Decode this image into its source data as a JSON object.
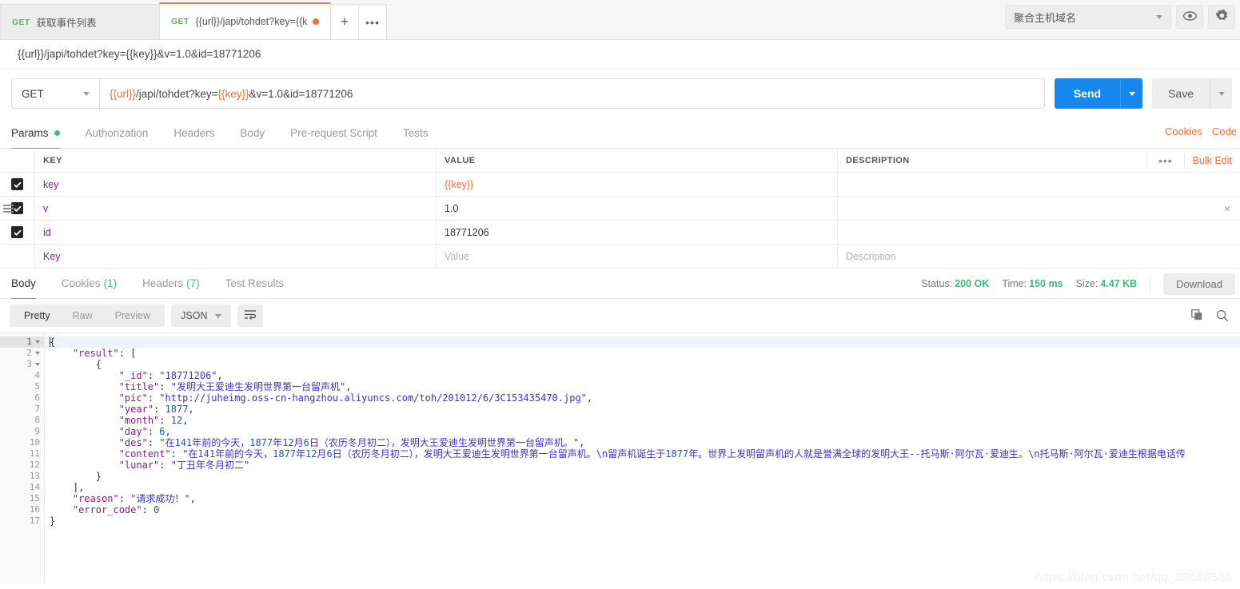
{
  "tabbar": {
    "tabs": [
      {
        "method": "GET",
        "title": "获取事件列表",
        "active": false,
        "dirty": false
      },
      {
        "method": "GET",
        "title": "{{url}}/japi/tohdet?key={{key}}&v",
        "active": true,
        "dirty": true
      }
    ],
    "new_tab_label": "+",
    "more_label": "•••",
    "environment": "聚合主机域名",
    "eye_icon": "eye-icon",
    "gear_icon": "gear-icon"
  },
  "url_preview": "{{url}}/japi/tohdet?key={{key}}&v=1.0&id=18771206",
  "request": {
    "method": "GET",
    "url_parts": [
      {
        "text": "{{url}}",
        "variable": true
      },
      {
        "text": "/japi/tohdet?key=",
        "variable": false
      },
      {
        "text": "{{key}}",
        "variable": true
      },
      {
        "text": "&v=1.0&id=18771206",
        "variable": false
      }
    ],
    "send_label": "Send",
    "save_label": "Save"
  },
  "request_tabs": {
    "items": [
      {
        "label": "Params",
        "active": true,
        "dot": true
      },
      {
        "label": "Authorization",
        "active": false,
        "dot": false
      },
      {
        "label": "Headers",
        "active": false,
        "dot": false
      },
      {
        "label": "Body",
        "active": false,
        "dot": false
      },
      {
        "label": "Pre-request Script",
        "active": false,
        "dot": false
      },
      {
        "label": "Tests",
        "active": false,
        "dot": false
      }
    ],
    "links": [
      "Cookies",
      "Code"
    ]
  },
  "params": {
    "columns": [
      "KEY",
      "VALUE",
      "DESCRIPTION"
    ],
    "dots_label": "•••",
    "bulk_edit_label": "Bulk Edit",
    "rows": [
      {
        "checked": true,
        "key": "key",
        "value": "{{key}}",
        "value_is_variable": true,
        "description": "",
        "hovered": false
      },
      {
        "checked": true,
        "key": "v",
        "value": "1.0",
        "value_is_variable": false,
        "description": "",
        "hovered": true
      },
      {
        "checked": true,
        "key": "id",
        "value": "18771206",
        "value_is_variable": false,
        "description": "",
        "hovered": false
      }
    ],
    "empty_row": {
      "key_placeholder": "Key",
      "value_placeholder": "Value",
      "description_placeholder": "Description"
    }
  },
  "response": {
    "tabs": [
      {
        "label": "Body",
        "count": "",
        "active": true
      },
      {
        "label": "Cookies",
        "count": "(1)",
        "active": false
      },
      {
        "label": "Headers",
        "count": "(7)",
        "active": false
      },
      {
        "label": "Test Results",
        "count": "",
        "active": false
      }
    ],
    "status_label": "Status:",
    "status_value": "200 OK",
    "time_label": "Time:",
    "time_value": "150 ms",
    "size_label": "Size:",
    "size_value": "4.47 KB",
    "download_label": "Download",
    "view_modes": [
      {
        "label": "Pretty",
        "active": true
      },
      {
        "label": "Raw",
        "active": false
      },
      {
        "label": "Preview",
        "active": false
      }
    ],
    "format": "JSON",
    "wrap_icon": "word-wrap-icon",
    "copy_icon": "copy-icon",
    "search_icon": "search-icon"
  },
  "code": {
    "lines": [
      {
        "n": 1,
        "fold": true,
        "active": true,
        "tokens": [
          {
            "t": "{",
            "c": "p"
          }
        ]
      },
      {
        "n": 2,
        "fold": true,
        "active": false,
        "tokens": [
          {
            "t": "    ",
            "c": "p"
          },
          {
            "t": "\"result\"",
            "c": "k"
          },
          {
            "t": ": [",
            "c": "p"
          }
        ]
      },
      {
        "n": 3,
        "fold": true,
        "active": false,
        "tokens": [
          {
            "t": "        {",
            "c": "p"
          }
        ]
      },
      {
        "n": 4,
        "fold": false,
        "active": false,
        "tokens": [
          {
            "t": "            ",
            "c": "p"
          },
          {
            "t": "\"_id\"",
            "c": "k"
          },
          {
            "t": ": ",
            "c": "p"
          },
          {
            "t": "\"18771206\"",
            "c": "s"
          },
          {
            "t": ",",
            "c": "p"
          }
        ]
      },
      {
        "n": 5,
        "fold": false,
        "active": false,
        "tokens": [
          {
            "t": "            ",
            "c": "p"
          },
          {
            "t": "\"title\"",
            "c": "k"
          },
          {
            "t": ": ",
            "c": "p"
          },
          {
            "t": "\"发明大王爱迪生发明世界第一台留声机\"",
            "c": "s"
          },
          {
            "t": ",",
            "c": "p"
          }
        ]
      },
      {
        "n": 6,
        "fold": false,
        "active": false,
        "tokens": [
          {
            "t": "            ",
            "c": "p"
          },
          {
            "t": "\"pic\"",
            "c": "k"
          },
          {
            "t": ": ",
            "c": "p"
          },
          {
            "t": "\"http://juheimg.oss-cn-hangzhou.aliyuncs.com/toh/201012/6/3C153435470.jpg\"",
            "c": "s"
          },
          {
            "t": ",",
            "c": "p"
          }
        ]
      },
      {
        "n": 7,
        "fold": false,
        "active": false,
        "tokens": [
          {
            "t": "            ",
            "c": "p"
          },
          {
            "t": "\"year\"",
            "c": "k"
          },
          {
            "t": ": ",
            "c": "p"
          },
          {
            "t": "1877",
            "c": "n"
          },
          {
            "t": ",",
            "c": "p"
          }
        ]
      },
      {
        "n": 8,
        "fold": false,
        "active": false,
        "tokens": [
          {
            "t": "            ",
            "c": "p"
          },
          {
            "t": "\"month\"",
            "c": "k"
          },
          {
            "t": ": ",
            "c": "p"
          },
          {
            "t": "12",
            "c": "n"
          },
          {
            "t": ",",
            "c": "p"
          }
        ]
      },
      {
        "n": 9,
        "fold": false,
        "active": false,
        "tokens": [
          {
            "t": "            ",
            "c": "p"
          },
          {
            "t": "\"day\"",
            "c": "k"
          },
          {
            "t": ": ",
            "c": "p"
          },
          {
            "t": "6",
            "c": "n"
          },
          {
            "t": ",",
            "c": "p"
          }
        ]
      },
      {
        "n": 10,
        "fold": false,
        "active": false,
        "tokens": [
          {
            "t": "            ",
            "c": "p"
          },
          {
            "t": "\"des\"",
            "c": "k"
          },
          {
            "t": ": ",
            "c": "p"
          },
          {
            "t": "\"在",
            "c": "s"
          },
          {
            "t": "141",
            "c": "n"
          },
          {
            "t": "年前的今天，",
            "c": "s"
          },
          {
            "t": "1877",
            "c": "n"
          },
          {
            "t": "年",
            "c": "s"
          },
          {
            "t": "12",
            "c": "n"
          },
          {
            "t": "月",
            "c": "s"
          },
          {
            "t": "6",
            "c": "n"
          },
          {
            "t": "日（农历冬月初二），发明大王爱迪生发明世界第一台留声机。\"",
            "c": "s"
          },
          {
            "t": ",",
            "c": "p"
          }
        ]
      },
      {
        "n": 11,
        "fold": false,
        "active": false,
        "tokens": [
          {
            "t": "            ",
            "c": "p"
          },
          {
            "t": "\"content\"",
            "c": "k"
          },
          {
            "t": ": ",
            "c": "p"
          },
          {
            "t": "\"在",
            "c": "s"
          },
          {
            "t": "141",
            "c": "n"
          },
          {
            "t": "年前的今天，",
            "c": "s"
          },
          {
            "t": "1877",
            "c": "n"
          },
          {
            "t": "年",
            "c": "s"
          },
          {
            "t": "12",
            "c": "n"
          },
          {
            "t": "月",
            "c": "s"
          },
          {
            "t": "6",
            "c": "n"
          },
          {
            "t": "日（农历冬月初二），发明大王爱迪生发明世界第一台留声机。\\n留声机诞生于",
            "c": "s"
          },
          {
            "t": "1877",
            "c": "n"
          },
          {
            "t": "年。世界上发明留声机的人就是誉满全球的发明大王--托马斯·阿尔瓦·爱迪生。\\n托马斯·阿尔瓦·爱迪生根据电话传",
            "c": "s"
          }
        ]
      },
      {
        "n": 12,
        "fold": false,
        "active": false,
        "tokens": [
          {
            "t": "            ",
            "c": "p"
          },
          {
            "t": "\"lunar\"",
            "c": "k"
          },
          {
            "t": ": ",
            "c": "p"
          },
          {
            "t": "\"丁丑年冬月初二\"",
            "c": "s"
          }
        ]
      },
      {
        "n": 13,
        "fold": false,
        "active": false,
        "tokens": [
          {
            "t": "        }",
            "c": "p"
          }
        ]
      },
      {
        "n": 14,
        "fold": false,
        "active": false,
        "tokens": [
          {
            "t": "    ],",
            "c": "p"
          }
        ]
      },
      {
        "n": 15,
        "fold": false,
        "active": false,
        "tokens": [
          {
            "t": "    ",
            "c": "p"
          },
          {
            "t": "\"reason\"",
            "c": "k"
          },
          {
            "t": ": ",
            "c": "p"
          },
          {
            "t": "\"请求成功！\"",
            "c": "s"
          },
          {
            "t": ",",
            "c": "p"
          }
        ]
      },
      {
        "n": 16,
        "fold": false,
        "active": false,
        "tokens": [
          {
            "t": "    ",
            "c": "p"
          },
          {
            "t": "\"error_code\"",
            "c": "k"
          },
          {
            "t": ": ",
            "c": "p"
          },
          {
            "t": "0",
            "c": "n"
          }
        ]
      },
      {
        "n": 17,
        "fold": false,
        "active": false,
        "tokens": [
          {
            "t": "}",
            "c": "p"
          }
        ]
      }
    ]
  },
  "watermark": "https://blog.csdn.net/qq_39680564",
  "colors": {
    "accent": "#ff6c37",
    "send": "#1787f0",
    "success": "#3dbd7d",
    "method": "#5bb75b",
    "json_key": "#8b1a8b",
    "json_string": "#3b2fdd",
    "json_number": "#1a53d8"
  }
}
